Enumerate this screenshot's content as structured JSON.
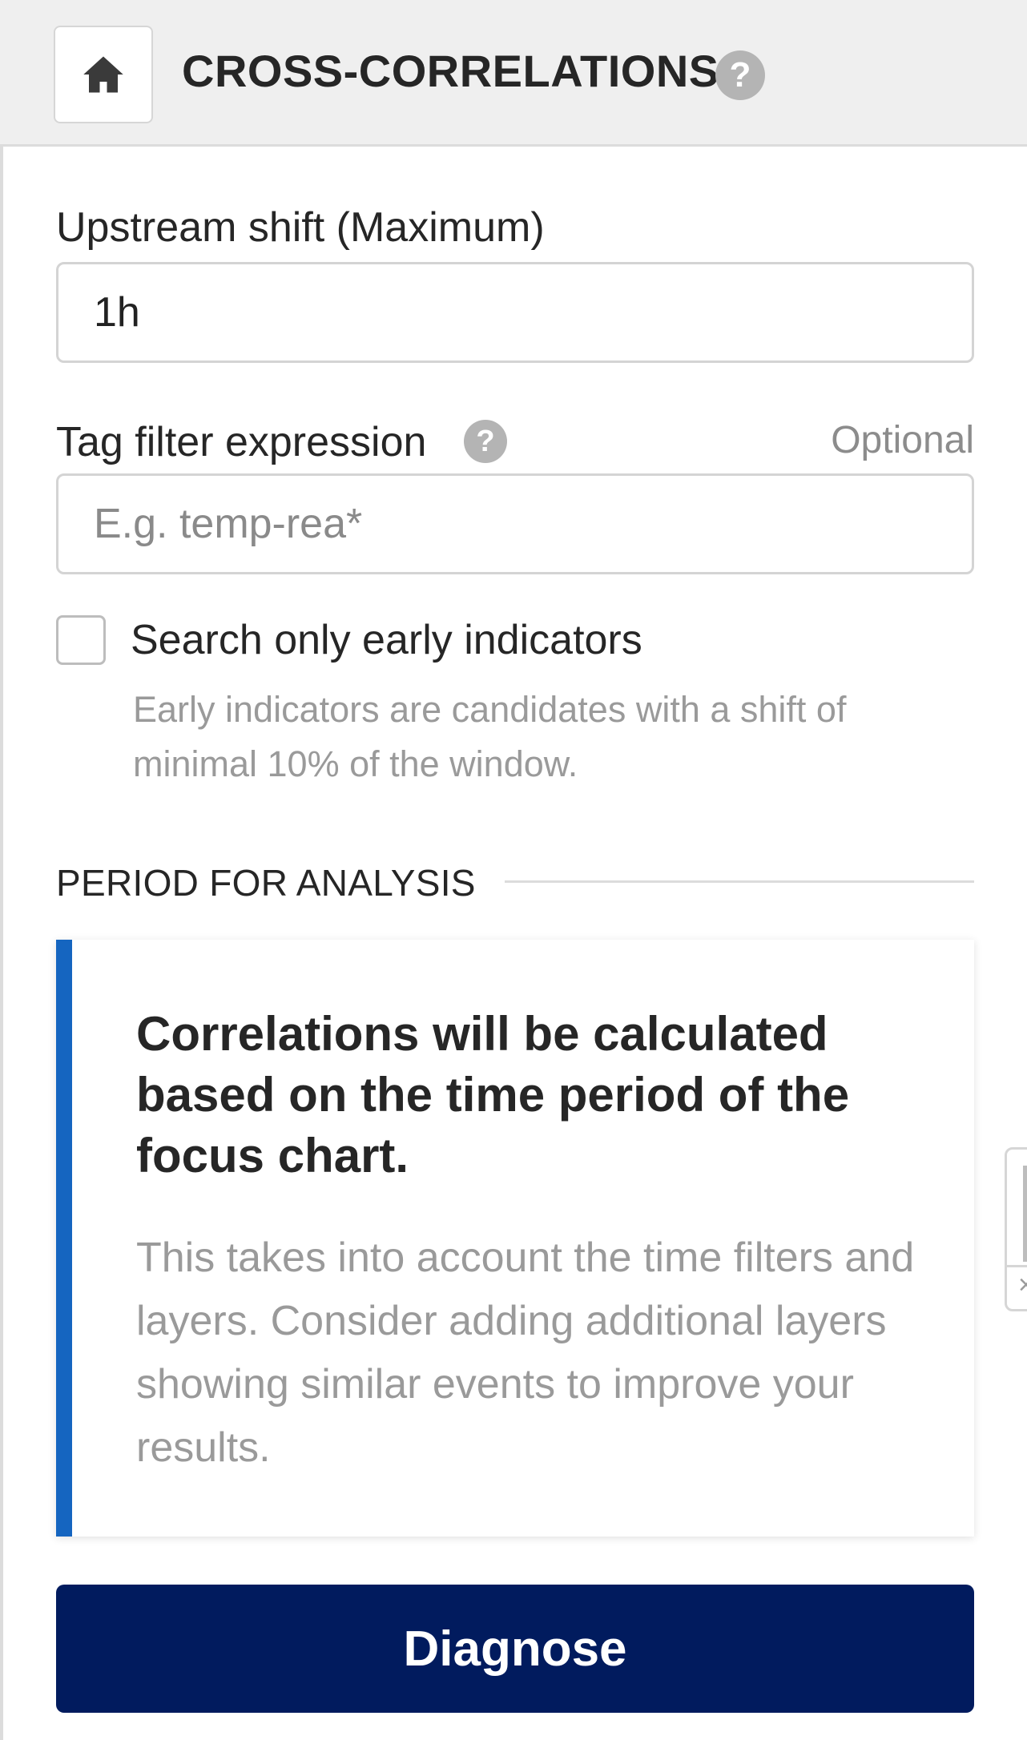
{
  "header": {
    "title": "CROSS-CORRELATIONS",
    "home_icon": "home-icon",
    "help_icon": "help-icon",
    "help_glyph": "?"
  },
  "form": {
    "upstream_shift": {
      "label": "Upstream shift (Maximum)",
      "value": "1h"
    },
    "tag_filter": {
      "label": "Tag filter expression",
      "help_glyph": "?",
      "optional_label": "Optional",
      "placeholder": "E.g. temp-rea*",
      "value": ""
    },
    "early_indicators": {
      "label": "Search only early indicators",
      "checked": false,
      "hint": "Early indicators are candidates with a shift of minimal 10% of the window."
    }
  },
  "period_section": {
    "title": "PERIOD FOR ANALYSIS"
  },
  "info_card": {
    "heading": "Correlations will be calculated based on the time period of the focus chart.",
    "body": "This takes into account the time filters and layers. Consider adding additional layers showing similar events to improve your results."
  },
  "actions": {
    "diagnose_label": "Diagnose"
  },
  "colors": {
    "accent_bar": "#1565c0",
    "primary_button": "#011b5e",
    "header_bg": "#efefef"
  }
}
